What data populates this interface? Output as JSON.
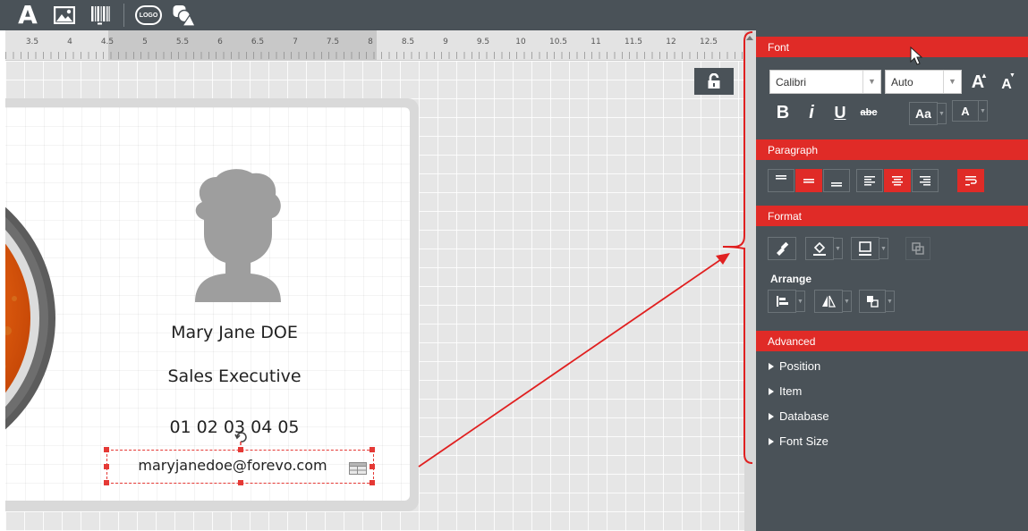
{
  "ruler": {
    "numbers": [
      "3.5",
      "4",
      "4.5",
      "5",
      "5.5",
      "6",
      "6.5",
      "7",
      "7.5",
      "8",
      "8.5",
      "9",
      "9.5",
      "10",
      "10.5",
      "11",
      "11.5",
      "12",
      "12.5"
    ]
  },
  "card": {
    "name": "Mary Jane DOE",
    "job_title": "Sales Executive",
    "phone": "01 02 03 04 05",
    "email": "maryjanedoe@forevo.com"
  },
  "toolbar": {
    "text_tool_label": "A",
    "logo_label": "LOGO"
  },
  "panel": {
    "font": {
      "header": "Font",
      "family_value": "Calibri",
      "size_value": "Auto",
      "bold_label": "B",
      "italic_label": "i",
      "underline_label": "U",
      "strike_label": "abc",
      "case_label": "Aa",
      "color_label": "A",
      "grow_label": "A",
      "shrink_label": "A"
    },
    "paragraph": {
      "header": "Paragraph"
    },
    "format": {
      "header": "Format",
      "arrange_label": "Arrange"
    },
    "advanced": {
      "header": "Advanced",
      "items": [
        "Position",
        "Item",
        "Database",
        "Font Size"
      ]
    }
  },
  "colors": {
    "accent": "#e02b27",
    "panel_bg": "#4a5258",
    "canvas_bg": "#e6e6e6",
    "avatar": "#9e9e9e",
    "selection": "#e53935",
    "annotation": "#e02020"
  },
  "icons": [
    "text-tool-icon",
    "image-tool-icon",
    "barcode-tool-icon",
    "logo-tool-icon",
    "shapes-tool-icon",
    "lock-icon",
    "scroll-up-icon",
    "database-field-icon",
    "mouse-cursor-icon"
  ]
}
